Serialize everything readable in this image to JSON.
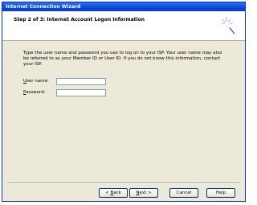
{
  "window": {
    "title": "Internet Connection Wizard"
  },
  "header": {
    "step_title": "Step 2 of 3: Internet Account Logon Information"
  },
  "body": {
    "description": "Type the user name and password you use to log on to your ISP. Your user name may also be referred to as your Member ID or User ID. If you do not know this information, contact your ISP.",
    "user_name": {
      "label_accel": "U",
      "label_rest": "ser name:",
      "value": ""
    },
    "password": {
      "label_accel": "P",
      "label_rest": "assword:",
      "value": ""
    }
  },
  "buttons": {
    "back": {
      "pre": "< ",
      "accel": "B",
      "rest": "ack"
    },
    "next": {
      "pre": "",
      "accel": "N",
      "rest": "ext >"
    },
    "cancel": {
      "pre": "",
      "accel": "",
      "rest": "Cancel"
    },
    "help": {
      "pre": "",
      "accel": "",
      "rest": "Help"
    }
  },
  "icons": {
    "wizard": "wizard-wand-icon"
  },
  "colors": {
    "titlebar": "#0a46d8",
    "face": "#ece9d8",
    "field_border": "#7f9db9"
  }
}
